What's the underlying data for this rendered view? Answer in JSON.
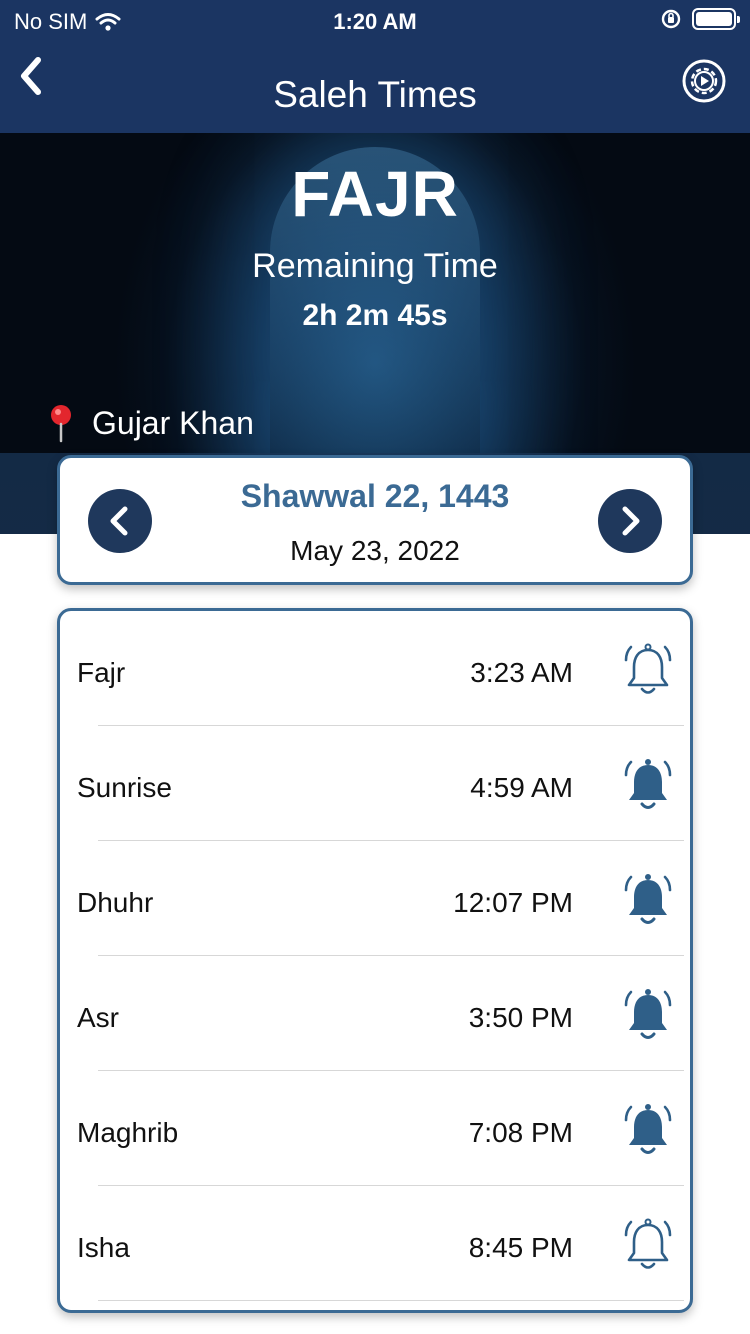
{
  "status_bar": {
    "carrier": "No SIM",
    "time": "1:20 AM"
  },
  "nav": {
    "title": "Saleh Times",
    "back_icon": "chevron-left-icon",
    "settings_icon": "gear-play-icon"
  },
  "hero": {
    "prayer": "FAJR",
    "remaining_label": "Remaining Time",
    "remaining_value": "2h 2m 45s",
    "location": "Gujar Khan",
    "location_icon": "map-pin-icon"
  },
  "date": {
    "hijri": "Shawwal 22, 1443",
    "gregorian": "May 23, 2022"
  },
  "prayers": [
    {
      "name": "Fajr",
      "time": "3:23 AM",
      "alarm": "outline"
    },
    {
      "name": "Sunrise",
      "time": "4:59 AM",
      "alarm": "filled"
    },
    {
      "name": "Dhuhr",
      "time": "12:07 PM",
      "alarm": "filled"
    },
    {
      "name": "Asr",
      "time": "3:50 PM",
      "alarm": "filled"
    },
    {
      "name": "Maghrib",
      "time": "7:08 PM",
      "alarm": "filled"
    },
    {
      "name": "Isha",
      "time": "8:45 PM",
      "alarm": "outline"
    }
  ],
  "colors": {
    "nav_bg": "#1b3562",
    "accent": "#3b6a94",
    "circle_btn": "#1f385c",
    "bell": "#2f5f88"
  }
}
